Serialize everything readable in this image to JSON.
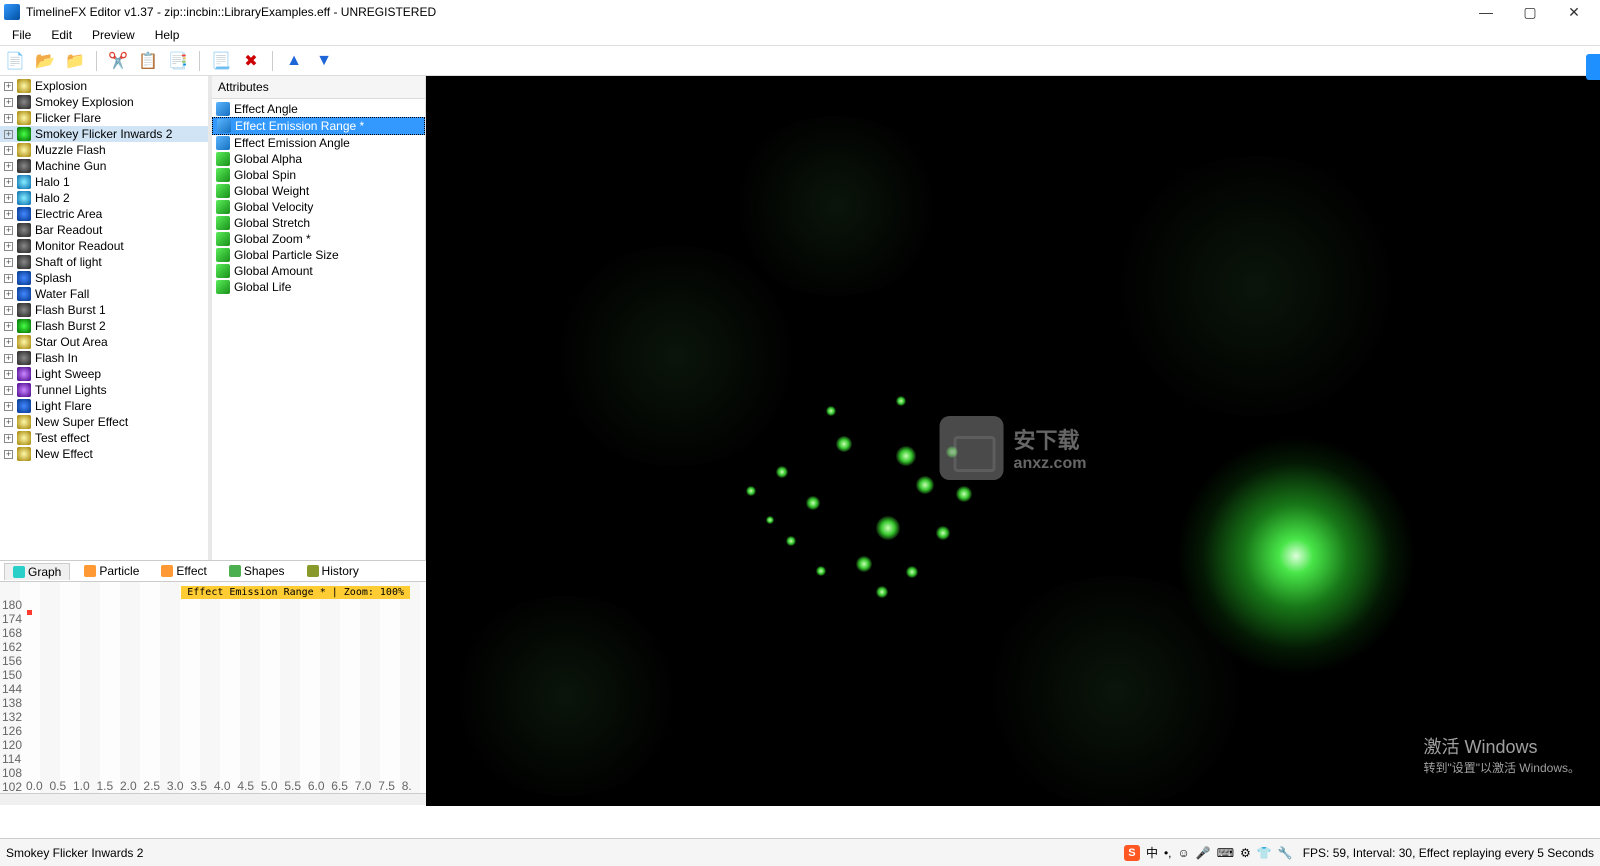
{
  "title": "TimelineFX Editor v1.37 - zip::incbin::LibraryExamples.eff - UNREGISTERED",
  "menu": [
    "File",
    "Edit",
    "Preview",
    "Help"
  ],
  "effects": [
    {
      "name": "Explosion",
      "ic": "star"
    },
    {
      "name": "Smokey Explosion",
      "ic": "dark"
    },
    {
      "name": "Flicker Flare",
      "ic": "star"
    },
    {
      "name": "Smokey Flicker Inwards 2",
      "ic": "green",
      "selected": true
    },
    {
      "name": "Muzzle Flash",
      "ic": "star"
    },
    {
      "name": "Machine Gun",
      "ic": "dark"
    },
    {
      "name": "Halo 1",
      "ic": "cyan"
    },
    {
      "name": "Halo 2",
      "ic": "cyan"
    },
    {
      "name": "Electric Area",
      "ic": "blue"
    },
    {
      "name": "Bar Readout",
      "ic": "dark"
    },
    {
      "name": "Monitor Readout",
      "ic": "dark"
    },
    {
      "name": "Shaft of light",
      "ic": "dark"
    },
    {
      "name": "Splash",
      "ic": "blue"
    },
    {
      "name": "Water Fall",
      "ic": "blue"
    },
    {
      "name": "Flash Burst 1",
      "ic": "dark"
    },
    {
      "name": "Flash Burst 2",
      "ic": "green"
    },
    {
      "name": "Star Out Area",
      "ic": "star"
    },
    {
      "name": "Flash In",
      "ic": "dark"
    },
    {
      "name": "Light Sweep",
      "ic": "purple"
    },
    {
      "name": "Tunnel Lights",
      "ic": "purple"
    },
    {
      "name": "Light Flare",
      "ic": "blue"
    },
    {
      "name": "New Super Effect",
      "ic": "star"
    },
    {
      "name": "Test effect",
      "ic": "star"
    },
    {
      "name": "New Effect",
      "ic": "star"
    }
  ],
  "attr_header": "Attributes",
  "attributes": [
    {
      "name": "Effect Angle",
      "ic": "blue"
    },
    {
      "name": "Effect Emission Range *",
      "ic": "blue",
      "selected": true
    },
    {
      "name": "Effect Emission Angle",
      "ic": "blue"
    },
    {
      "name": "Global Alpha",
      "ic": "green"
    },
    {
      "name": "Global Spin",
      "ic": "green"
    },
    {
      "name": "Global Weight",
      "ic": "green"
    },
    {
      "name": "Global Velocity",
      "ic": "green"
    },
    {
      "name": "Global Stretch",
      "ic": "green"
    },
    {
      "name": "Global Zoom *",
      "ic": "green"
    },
    {
      "name": "Global Particle Size",
      "ic": "green"
    },
    {
      "name": "Global Amount",
      "ic": "green"
    },
    {
      "name": "Global Life",
      "ic": "green"
    }
  ],
  "tabs": [
    {
      "name": "Graph",
      "ic": "teal",
      "active": true
    },
    {
      "name": "Particle",
      "ic": "orange"
    },
    {
      "name": "Effect",
      "ic": "orange"
    },
    {
      "name": "Shapes",
      "ic": "green"
    },
    {
      "name": "History",
      "ic": "olive"
    }
  ],
  "graph_label": "Effect Emission Range * | Zoom: 100%",
  "y_ticks": [
    "180",
    "174",
    "168",
    "162",
    "156",
    "150",
    "144",
    "138",
    "132",
    "126",
    "120",
    "114",
    "108",
    "102"
  ],
  "x_ticks": [
    "0.0",
    "0.5",
    "1.0",
    "1.5",
    "2.0",
    "2.5",
    "3.0",
    "3.5",
    "4.0",
    "4.5",
    "5.0",
    "5.5",
    "6.0",
    "6.5",
    "7.0",
    "7.5",
    "8."
  ],
  "status_left": "Smokey Flicker Inwards 2",
  "ime_text": "中",
  "status_right": "FPS: 59, Interval: 30, Effect replaying every 5 Seconds",
  "activate1": "激活 Windows",
  "activate2": "转到\"设置\"以激活 Windows。",
  "watermark": "安下载",
  "watermark_url": "anxz.com"
}
